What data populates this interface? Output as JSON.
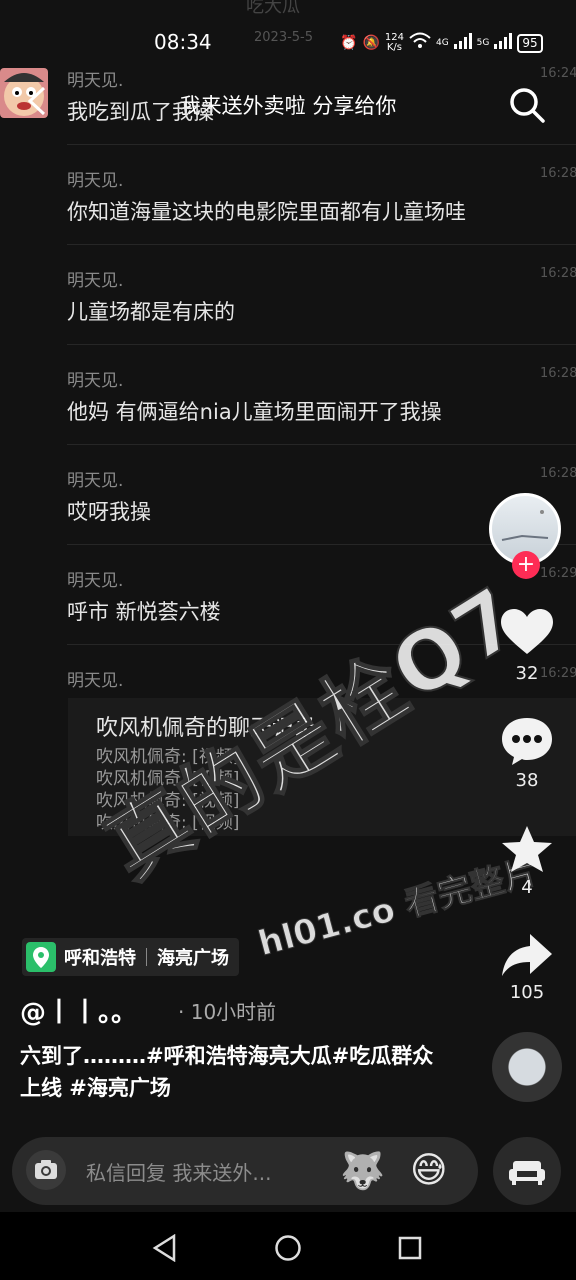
{
  "status_bar": {
    "ghost_title": "吃大瓜",
    "time": "08:34",
    "date": "2023-5-5",
    "net_speed_value": "124",
    "net_speed_unit": "K/s",
    "signal_4g": "4G",
    "signal_5g": "5G",
    "battery": "95"
  },
  "header": {
    "title": "我来送外卖啦 分享给你"
  },
  "chat": {
    "messages": [
      {
        "name": "明天见.",
        "time": "16:24",
        "text": "我吃到瓜了我操"
      },
      {
        "name": "明天见.",
        "time": "16:28",
        "text": "你知道海量这块的电影院里面都有儿童场哇"
      },
      {
        "name": "明天见.",
        "time": "16:28",
        "text": "儿童场都是有床的"
      },
      {
        "name": "明天见.",
        "time": "16:28",
        "text": "他妈 有俩逼给nia儿童场里面闹开了我操"
      },
      {
        "name": "明天见.",
        "time": "16:28",
        "text": "哎呀我操"
      },
      {
        "name": "明天见.",
        "time": "16:29",
        "text": "呼市 新悦荟六楼"
      },
      {
        "name": "明天见.",
        "time": "16:29",
        "text": ""
      }
    ],
    "card": {
      "title": "吹风机佩奇的聊天记录",
      "lines": [
        "吹风机佩奇: [视频]",
        "吹风机佩奇: [视频]",
        "吹风机佩奇: [视频]",
        "吹风机佩奇: [视频]"
      ]
    }
  },
  "watermark": {
    "main": "真的是栓Q7",
    "site": "hl01.co 看完整片"
  },
  "rail": {
    "follow_symbol": "+",
    "likes": "32",
    "comments": "38",
    "favorites": "4",
    "shares": "105"
  },
  "video_info": {
    "location_city": "呼和浩特",
    "location_place": "海亮广场",
    "author": "@丨丨。。",
    "time_ago": "· 10小时前",
    "caption": "六到了………#呼和浩特海亮大瓜#吃瓜群众上线 #海亮广场"
  },
  "input_bar": {
    "placeholder": "私信回复 我来送外..."
  },
  "colors": {
    "background": "#121212",
    "accent": "#fe2c55",
    "location_green": "#2bbf6a"
  }
}
